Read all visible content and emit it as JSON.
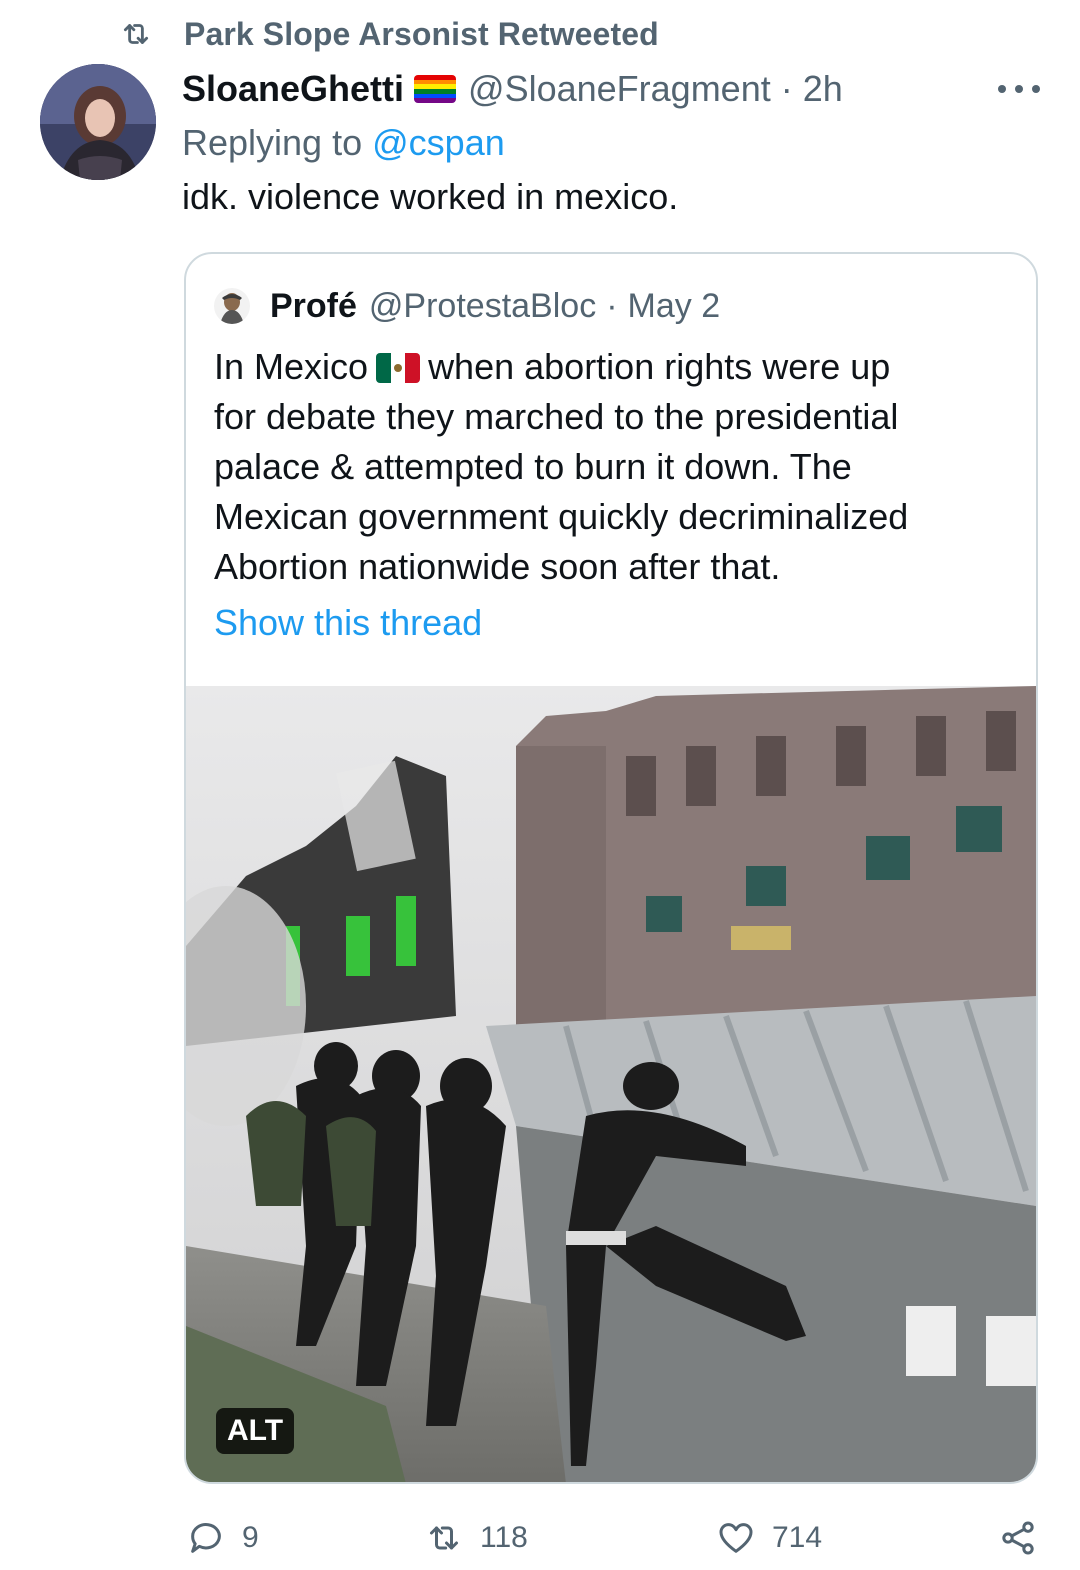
{
  "retweet": {
    "icon": "retweet-icon",
    "text": "Park Slope Arsonist Retweeted"
  },
  "tweet": {
    "display_name": "SloaneGhetti",
    "flag": "rainbow-flag-emoji",
    "handle": "@SloaneFragment",
    "separator": "·",
    "time": "2h",
    "more_icon": "more-icon",
    "reply_prefix": "Replying to",
    "reply_to": "@cspan",
    "text": "idk. violence worked in mexico."
  },
  "quote": {
    "display_name": "Profé",
    "handle": "@ProtestaBloc",
    "separator": "·",
    "date": "May 2",
    "line1_a": "In Mexico",
    "flag": "mexico-flag-emoji",
    "line1_b": "when abortion rights were up",
    "line2": "for debate they marched to the presidential",
    "line3": "palace & attempted to burn it down. The",
    "line4": "Mexican government quickly decriminalized",
    "line5": "Abortion nationwide soon after that.",
    "show_thread": "Show this thread",
    "alt_badge": "ALT"
  },
  "actions": {
    "reply": {
      "icon": "reply-icon",
      "count": "9"
    },
    "retweet": {
      "icon": "retweet-icon",
      "count": "118"
    },
    "like": {
      "icon": "heart-icon",
      "count": "714"
    },
    "share": {
      "icon": "share-icon"
    }
  },
  "colors": {
    "accent": "#1d9bf0",
    "secondary_text": "#536471",
    "primary_text": "#0f1419",
    "border": "#cfd9de"
  }
}
